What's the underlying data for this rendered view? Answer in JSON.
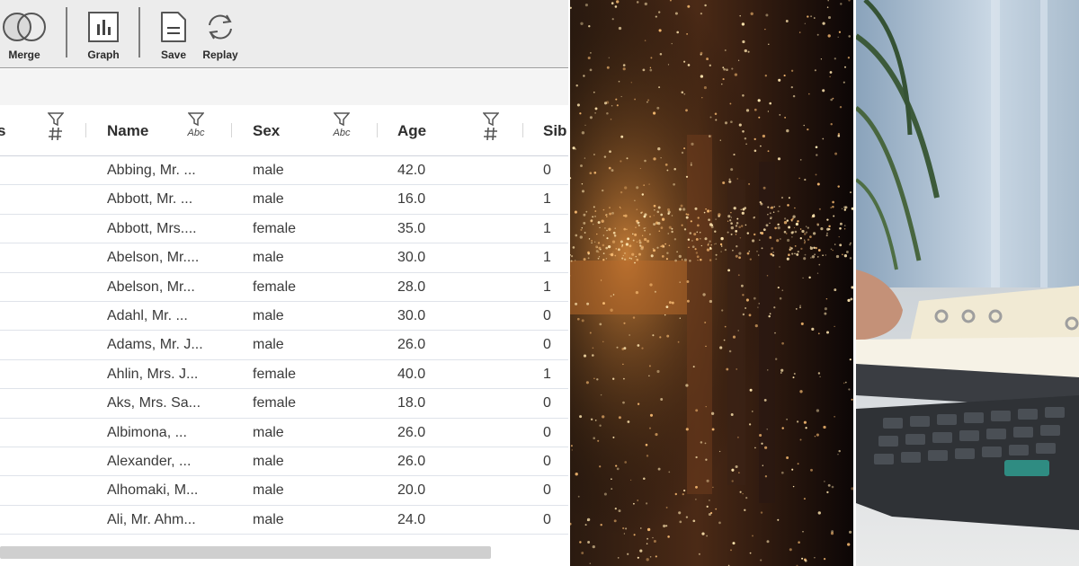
{
  "toolbar": {
    "merge_label": "Merge",
    "graph_label": "Graph",
    "save_label": "Save",
    "replay_label": "Replay"
  },
  "table": {
    "columns": [
      {
        "name": "s",
        "type_label": ""
      },
      {
        "name": "Name",
        "type_label": "Abc"
      },
      {
        "name": "Sex",
        "type_label": "Abc"
      },
      {
        "name": "Age",
        "type_label": ""
      },
      {
        "name": "Sib",
        "type_label": ""
      }
    ],
    "rows": [
      {
        "name": "Abbing, Mr. ...",
        "sex": "male",
        "age": "42.0",
        "sib": "0"
      },
      {
        "name": "Abbott, Mr. ...",
        "sex": "male",
        "age": "16.0",
        "sib": "1"
      },
      {
        "name": "Abbott, Mrs....",
        "sex": "female",
        "age": "35.0",
        "sib": "1"
      },
      {
        "name": "Abelson, Mr....",
        "sex": "male",
        "age": "30.0",
        "sib": "1"
      },
      {
        "name": "Abelson, Mr...",
        "sex": "female",
        "age": "28.0",
        "sib": "1"
      },
      {
        "name": "Adahl, Mr. ...",
        "sex": "male",
        "age": "30.0",
        "sib": "0"
      },
      {
        "name": "Adams, Mr. J...",
        "sex": "male",
        "age": "26.0",
        "sib": "0"
      },
      {
        "name": "Ahlin, Mrs. J...",
        "sex": "female",
        "age": "40.0",
        "sib": "1"
      },
      {
        "name": "Aks, Mrs. Sa...",
        "sex": "female",
        "age": "18.0",
        "sib": "0"
      },
      {
        "name": "Albimona, ...",
        "sex": "male",
        "age": "26.0",
        "sib": "0"
      },
      {
        "name": "Alexander, ...",
        "sex": "male",
        "age": "26.0",
        "sib": "0"
      },
      {
        "name": "Alhomaki, M...",
        "sex": "male",
        "age": "20.0",
        "sib": "0"
      },
      {
        "name": "Ali, Mr. Ahm...",
        "sex": "male",
        "age": "24.0",
        "sib": "0"
      }
    ]
  },
  "icons": {
    "merge": "merge-icon",
    "graph": "graph-icon",
    "save": "save-icon",
    "replay": "replay-icon",
    "filter": "filter-icon",
    "number_type": "hash-icon"
  },
  "colors": {
    "toolbar_bg": "#ececec",
    "header_text": "#2e2e2e",
    "cell_text": "#3a3a3a",
    "row_border": "#dfe3ea"
  }
}
